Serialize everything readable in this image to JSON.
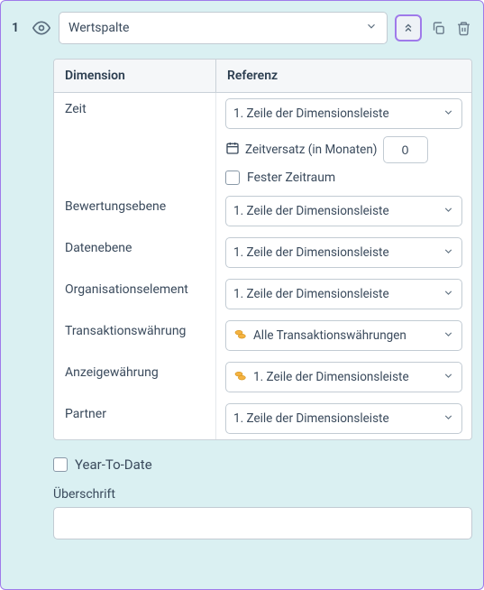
{
  "index": "1",
  "mainSelect": "Wertspalte",
  "table": {
    "headers": {
      "dim": "Dimension",
      "ref": "Referenz"
    },
    "zeit": {
      "label": "Zeit",
      "value": "1. Zeile der Dimensionsleiste",
      "offsetLabel": "Zeitversatz (in Monaten)",
      "offsetValue": "0",
      "fixedLabel": "Fester Zeitraum"
    },
    "rows": [
      {
        "label": "Bewertungsebene",
        "value": "1. Zeile der Dimensionsleiste",
        "icon": null
      },
      {
        "label": "Datenebene",
        "value": "1. Zeile der Dimensionsleiste",
        "icon": null
      },
      {
        "label": "Organisationselement",
        "value": "1. Zeile der Dimensionsleiste",
        "icon": null
      },
      {
        "label": "Transaktionswährung",
        "value": "Alle Transaktionswährungen",
        "icon": "coins"
      },
      {
        "label": "Anzeigewährung",
        "value": "1. Zeile der Dimensionsleiste",
        "icon": "coins"
      },
      {
        "label": "Partner",
        "value": "1. Zeile der Dimensionsleiste",
        "icon": null
      }
    ]
  },
  "ytd": "Year-To-Date",
  "heading": {
    "label": "Überschrift",
    "value": ""
  }
}
